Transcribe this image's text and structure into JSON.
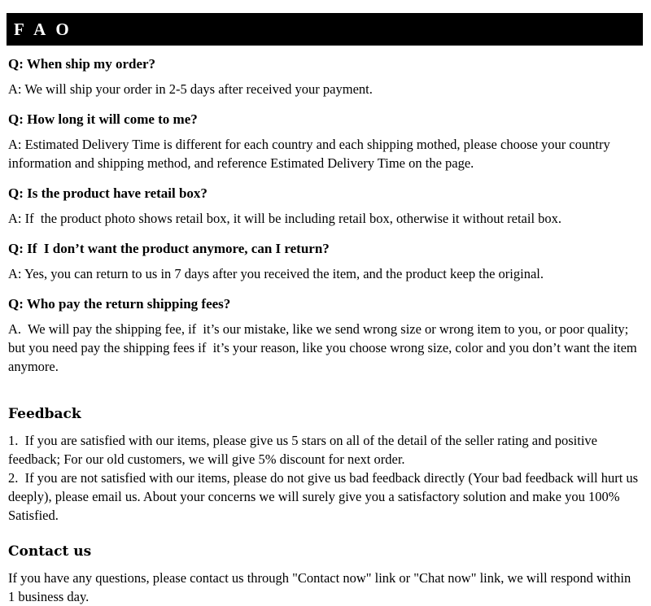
{
  "header": {
    "title": "F A O"
  },
  "faq": {
    "items": [
      {
        "question": "Q: When ship my order?",
        "answer": "A: We will ship your order in 2-5 days after received your payment."
      },
      {
        "question": "Q: How long it will come to me?",
        "answer": "A: Estimated Delivery Time is different for each country and each shipping mothed, please choose your country information and shipping method, and reference Estimated Delivery Time on the page."
      },
      {
        "question": "Q: Is the product have retail box?",
        "answer": "A: If  the product photo shows retail box, it will be including retail box, otherwise it without retail box."
      },
      {
        "question": "Q: If  I don’t want the product anymore, can I return?",
        "answer": "A: Yes, you can return to us in 7 days after you received the item, and the product keep the original."
      },
      {
        "question": "Q: Who pay the return shipping fees?",
        "answer": "A.  We will pay the shipping fee, if  it’s our mistake, like we send wrong size or wrong item to you, or poor quality; but you need pay the shipping fees if  it’s your reason, like you choose wrong size, color and you don’t want the item anymore."
      }
    ]
  },
  "feedback": {
    "heading": "Feedback",
    "items": [
      "1.  If you are satisfied with our items, please give us 5 stars on all of the detail of the seller rating and positive feedback; For our old customers, we will give 5% discount for next order.",
      "2.  If you are not satisfied with our items, please do not give us bad feedback directly (Your bad feedback will hurt us deeply), please email us. About your concerns we will surely give you a satisfactory solution and make you 100% Satisfied."
    ]
  },
  "contact": {
    "heading": "Contact us",
    "body": "If you have any questions, please contact us through \"Contact now\" link or \"Chat now\" link, we will respond within 1 business day."
  },
  "colors": {
    "header_background": "#000000",
    "header_text": "#ffffff",
    "page_background": "#ffffff",
    "body_text": "#000000"
  }
}
